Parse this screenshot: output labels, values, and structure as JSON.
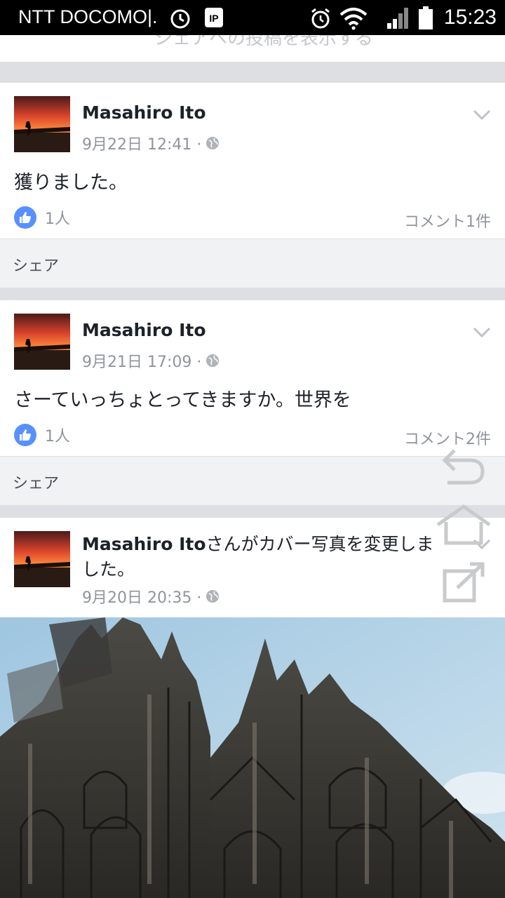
{
  "statusbar": {
    "carrier": "NTT DOCOMO|.",
    "time": "15:23"
  },
  "feed": {
    "top_partial_text": "シェアへの投稿を表示する",
    "posts": [
      {
        "author": "Masahiro Ito",
        "date": "9月22日 12:41 ·",
        "text": "獲りました。",
        "likes": "1人",
        "comments": "コメント1件",
        "share": "シェア"
      },
      {
        "author": "Masahiro Ito",
        "date": "9月21日 17:09 ·",
        "text": "さーていっちょとってきますか。世界を",
        "likes": "1人",
        "comments": "コメント2件",
        "share": "シェア"
      },
      {
        "author": "Masahiro Ito",
        "author_suffix_line1": "さんがカバー写真を変更しま",
        "author_suffix_line2": "した。",
        "date": "9月20日 20:35 ·"
      }
    ]
  },
  "icons": {
    "globe": "globe-icon",
    "like": "thumbs-up-icon",
    "chevron": "chevron-down-icon",
    "back": "back-arrow-icon",
    "home": "home-icon",
    "share_overlay": "share-out-icon"
  },
  "colors": {
    "like_blue": "#5890ff",
    "text_primary": "#1d2129",
    "text_secondary": "#90949c"
  }
}
